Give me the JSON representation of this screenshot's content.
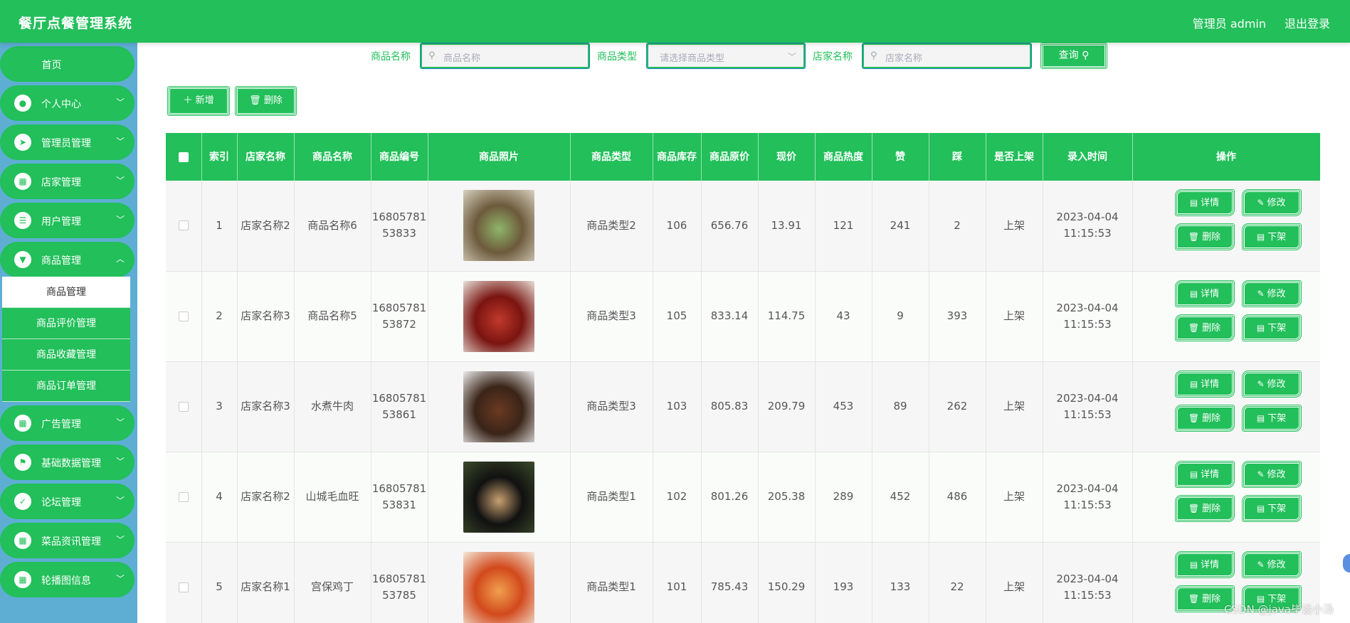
{
  "header": {
    "title": "餐厅点餐管理系统",
    "user": "管理员 admin",
    "logout": "退出登录"
  },
  "sidebar": {
    "home": "首页",
    "menus": [
      {
        "label": "个人中心",
        "icon": "user-icon"
      },
      {
        "label": "管理员管理",
        "icon": "send-icon"
      },
      {
        "label": "店家管理",
        "icon": "grid-icon"
      },
      {
        "label": "用户管理",
        "icon": "list-icon"
      },
      {
        "label": "商品管理",
        "icon": "goods-icon"
      },
      {
        "label": "广告管理",
        "icon": "grid-icon"
      },
      {
        "label": "基础数据管理",
        "icon": "flag-icon"
      },
      {
        "label": "论坛管理",
        "icon": "clipboard-icon"
      },
      {
        "label": "菜品资讯管理",
        "icon": "grid-icon"
      },
      {
        "label": "轮播图信息",
        "icon": "grid-icon"
      }
    ],
    "submenu": [
      "商品管理",
      "商品评价管理",
      "商品收藏管理",
      "商品订单管理"
    ]
  },
  "search": {
    "name_label": "商品名称",
    "name_placeholder": "商品名称",
    "type_label": "商品类型",
    "type_placeholder": "请选择商品类型",
    "shop_label": "店家名称",
    "shop_placeholder": "店家名称",
    "query": "查询"
  },
  "actions": {
    "add": "新增",
    "delete": "删除"
  },
  "table": {
    "headers": [
      "",
      "索引",
      "店家名称",
      "商品名称",
      "商品编号",
      "商品照片",
      "商品类型",
      "商品库存",
      "商品原价",
      "现价",
      "商品热度",
      "赞",
      "踩",
      "是否上架",
      "录入时间",
      "操作"
    ],
    "rows": [
      {
        "index": "1",
        "shop": "店家名称2",
        "name": "商品名称6",
        "code": "1680578153833",
        "type": "商品类型2",
        "stock": "106",
        "orig": "656.76",
        "price": "13.91",
        "heat": "121",
        "like": "241",
        "dislike": "2",
        "status": "上架",
        "time": "2023-04-04 11:15:53",
        "photo_colors": [
          "#6d5a3c",
          "#8fb56a",
          "#d8d2c0"
        ]
      },
      {
        "index": "2",
        "shop": "店家名称3",
        "name": "商品名称5",
        "code": "1680578153872",
        "type": "商品类型3",
        "stock": "105",
        "orig": "833.14",
        "price": "114.75",
        "heat": "43",
        "like": "9",
        "dislike": "393",
        "status": "上架",
        "time": "2023-04-04 11:15:53",
        "photo_colors": [
          "#7a1410",
          "#c0392b",
          "#e8e0d8"
        ]
      },
      {
        "index": "3",
        "shop": "店家名称3",
        "name": "水煮牛肉",
        "code": "1680578153861",
        "type": "商品类型3",
        "stock": "103",
        "orig": "805.83",
        "price": "209.79",
        "heat": "453",
        "like": "89",
        "dislike": "262",
        "status": "上架",
        "time": "2023-04-04 11:15:53",
        "photo_colors": [
          "#3a2418",
          "#6b3a22",
          "#ececec"
        ]
      },
      {
        "index": "4",
        "shop": "店家名称2",
        "name": "山城毛血旺",
        "code": "1680578153831",
        "type": "商品类型1",
        "stock": "102",
        "orig": "801.26",
        "price": "205.38",
        "heat": "289",
        "like": "452",
        "dislike": "486",
        "status": "上架",
        "time": "2023-04-04 11:15:53",
        "photo_colors": [
          "#111111",
          "#c8a070",
          "#3a4a2a"
        ]
      },
      {
        "index": "5",
        "shop": "店家名称1",
        "name": "宫保鸡丁",
        "code": "1680578153785",
        "type": "商品类型1",
        "stock": "101",
        "orig": "785.43",
        "price": "150.29",
        "heat": "193",
        "like": "133",
        "dislike": "22",
        "status": "上架",
        "time": "2023-04-04 11:15:53",
        "photo_colors": [
          "#d2491c",
          "#f0a050",
          "#f4e8d8"
        ]
      }
    ],
    "ops": {
      "detail": "详情",
      "edit": "修改",
      "delete": "删除",
      "offshelf": "下架"
    }
  },
  "watermark": "CSDN @java毕设小汤",
  "colors": {
    "primary": "#22bf5a",
    "sidebar_bg": "#5eaed4"
  }
}
